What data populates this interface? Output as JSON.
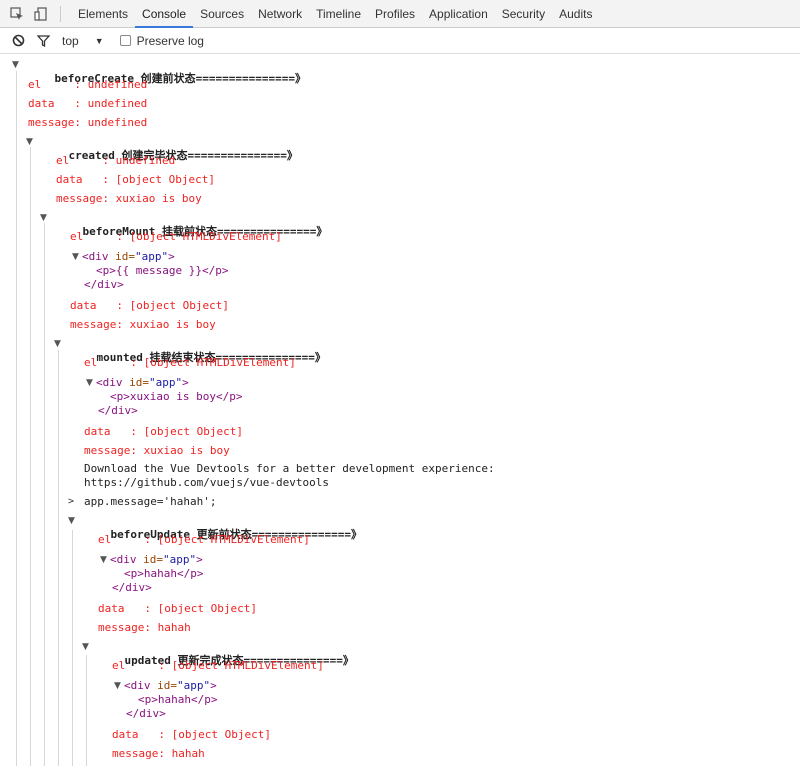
{
  "toolbar": {
    "tabs": [
      "Elements",
      "Console",
      "Sources",
      "Network",
      "Timeline",
      "Profiles",
      "Application",
      "Security",
      "Audits"
    ],
    "active_tab": "Console",
    "icons": [
      "inspect-icon",
      "device-icon"
    ]
  },
  "filterbar": {
    "context": "top",
    "preserve_log": "Preserve log"
  },
  "logs": {
    "g1_header_code": "beforeCreate",
    "g1_header_cjk": "创建前状态",
    "g1_header_tail": "===============》",
    "g1_el": "el     : undefined",
    "g1_data": "data   : undefined",
    "g1_msg": "message: undefined",
    "g2_header_code": "created",
    "g2_header_cjk": "创建完毕状态",
    "g2_header_tail": "===============》",
    "g2_el": "el     : undefined",
    "g2_data": "data   : [object Object]",
    "g2_msg": "message: xuxiao is boy",
    "g3_header_code": "beforeMount",
    "g3_header_cjk": "挂载前状态",
    "g3_header_tail": "===============》",
    "g3_el": "el     : [object HTMLDivElement]",
    "g3_div_open_a": "<div ",
    "g3_div_attr": "id=",
    "g3_div_val": "\"app\"",
    "g3_div_close": ">",
    "g3_p_line": "<p>{{ message }}</p>",
    "g3_div_end": "</div>",
    "g3_data": "data   : [object Object]",
    "g3_msg": "message: xuxiao is boy",
    "g4_header_code": "mounted",
    "g4_header_cjk": "挂载结束状态",
    "g4_header_tail": "===============》",
    "g4_el": "el     : [object HTMLDivElement]",
    "g4_p_line": "<p>xuxiao is boy</p>",
    "g4_data": "data   : [object Object]",
    "g4_msg": "message: xuxiao is boy",
    "devtools_line1": "Download the Vue Devtools for a better development experience:",
    "devtools_line2": "https://github.com/vuejs/vue-devtools",
    "input_cmd": "app.message='hahah';",
    "g5_header_code": "beforeUpdate",
    "g5_header_cjk": "更新前状态",
    "g5_header_tail": "===============》",
    "g5_el": "el     : [object HTMLDivElement]",
    "g5_p_line": "<p>hahah</p>",
    "g5_data": "data   : [object Object]",
    "g5_msg": "message: hahah",
    "g6_header_code": "updated",
    "g6_header_cjk": "更新完成状态",
    "g6_header_tail": "===============》",
    "g6_el": "el     : [object HTMLDivElement]",
    "g6_p_line": "<p>hahah</p>",
    "g6_data": "data   : [object Object]",
    "g6_msg": "message: hahah"
  },
  "colors": {
    "log_red": "#e22",
    "tag": "#881280",
    "attr": "#994500",
    "attr_value": "#1a1aa6",
    "active_tab_underline": "#3879d9"
  }
}
